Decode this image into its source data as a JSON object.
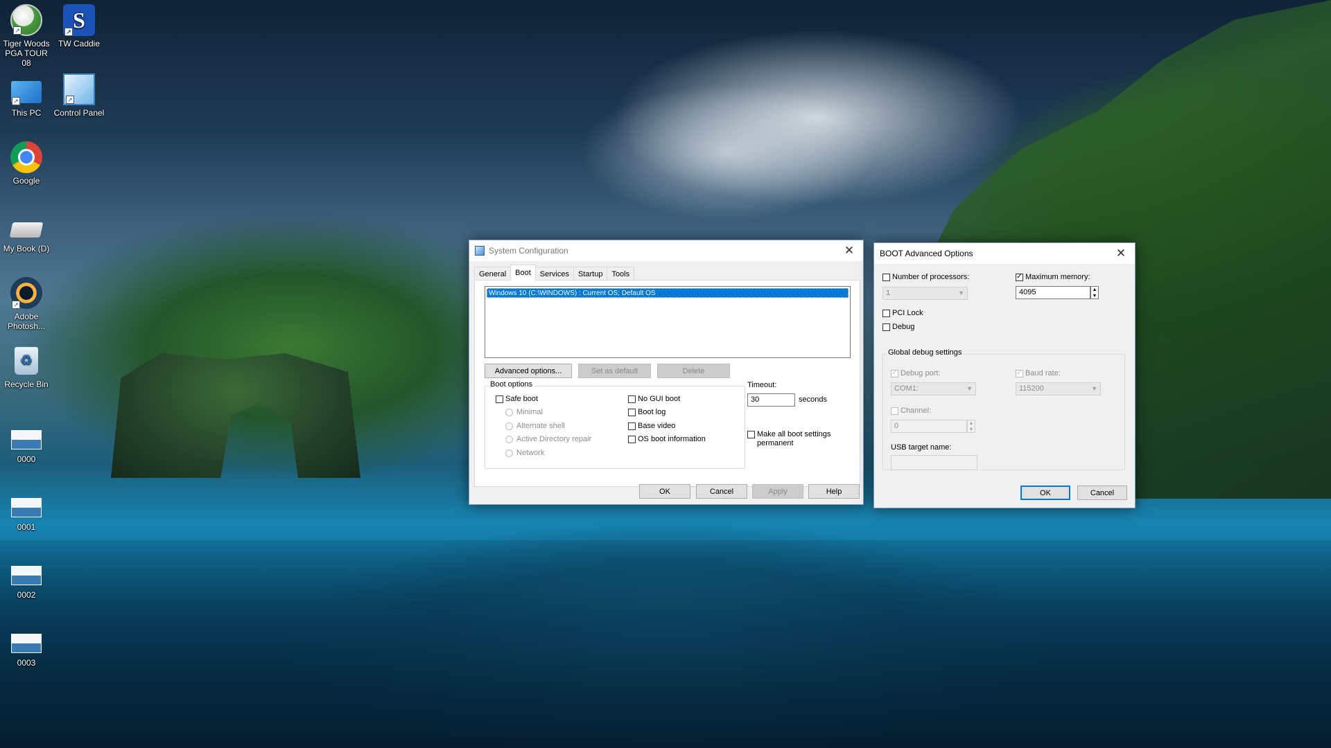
{
  "desktop": {
    "icons": [
      {
        "label": "Tiger Woods PGA TOUR 08",
        "icon": "golf-ball-icon"
      },
      {
        "label": "TW Caddie",
        "icon": "caddie-app-icon"
      },
      {
        "label": "This PC",
        "icon": "computer-icon"
      },
      {
        "label": "Control Panel",
        "icon": "control-panel-icon"
      },
      {
        "label": "Google",
        "icon": "chrome-icon"
      },
      {
        "label": "My Book (D)",
        "icon": "drive-icon"
      },
      {
        "label": "Adobe Photosh...",
        "icon": "photoshop-icon"
      },
      {
        "label": "Recycle Bin",
        "icon": "recycle-bin-icon"
      },
      {
        "label": "0000",
        "icon": "image-file-icon"
      },
      {
        "label": "0001",
        "icon": "image-file-icon"
      },
      {
        "label": "0002",
        "icon": "image-file-icon"
      },
      {
        "label": "0003",
        "icon": "image-file-icon"
      }
    ]
  },
  "syscfg": {
    "title": "System Configuration",
    "tabs": [
      "General",
      "Boot",
      "Services",
      "Startup",
      "Tools"
    ],
    "active_tab": "Boot",
    "os_entries": [
      "Windows 10 (C:\\WINDOWS) : Current OS; Default OS"
    ],
    "buttons": {
      "advanced": "Advanced options...",
      "set_default": "Set as default",
      "delete": "Delete",
      "ok": "OK",
      "cancel": "Cancel",
      "apply": "Apply",
      "help": "Help"
    },
    "boot_options_label": "Boot options",
    "safe_boot": {
      "label": "Safe boot",
      "checked": false
    },
    "safe_modes": [
      "Minimal",
      "Alternate shell",
      "Active Directory repair",
      "Network"
    ],
    "right_options": [
      {
        "label": "No GUI boot",
        "checked": false
      },
      {
        "label": "Boot log",
        "checked": false
      },
      {
        "label": "Base video",
        "checked": false
      },
      {
        "label": "OS boot information",
        "checked": false
      }
    ],
    "timeout": {
      "label": "Timeout:",
      "value": "30",
      "unit": "seconds"
    },
    "permanent": {
      "label_line1": "Make all boot settings",
      "label_line2": "permanent",
      "checked": false
    }
  },
  "boot_adv": {
    "title": "BOOT Advanced Options",
    "num_processors": {
      "label": "Number of processors:",
      "checked": false,
      "value": "1"
    },
    "max_memory": {
      "label": "Maximum memory:",
      "checked": true,
      "value": "4095"
    },
    "pci_lock": {
      "label": "PCI Lock",
      "checked": false
    },
    "debug": {
      "label": "Debug",
      "checked": false
    },
    "global_debug_label": "Global debug settings",
    "debug_port": {
      "label": "Debug port:",
      "value": "COM1:"
    },
    "baud_rate": {
      "label": "Baud rate:",
      "value": "115200"
    },
    "channel": {
      "label": "Channel:",
      "value": "0"
    },
    "usb_target": {
      "label": "USB target name:",
      "value": ""
    },
    "ok": "OK",
    "cancel": "Cancel"
  }
}
